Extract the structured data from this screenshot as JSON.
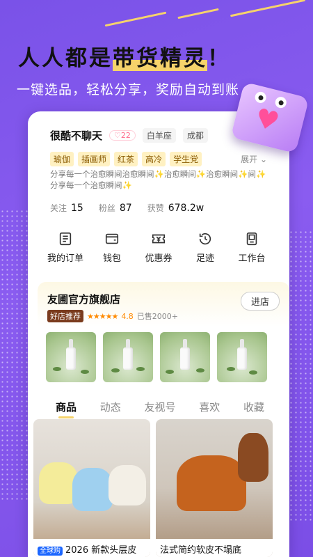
{
  "hero": {
    "headline_pre": "人人都是",
    "headline_hl": "带货精灵",
    "headline_post": "！",
    "subheadline": "一键选品，轻松分享，奖励自动到账"
  },
  "colors": {
    "background": "#7a52e8",
    "accent_yellow": "#f6d36b",
    "heart": "#ff4f9a"
  },
  "profile": {
    "username": "很酷不聊天",
    "fans_badge": "22",
    "zodiac": "白羊座",
    "city": "成都",
    "tags": [
      "瑜伽",
      "插画师",
      "红茶",
      "高冷",
      "学生党"
    ],
    "expand_label": "展开",
    "bio": "分享每一个治愈瞬间治愈瞬间✨治愈瞬间✨治愈瞬间✨间✨分享每一个治愈瞬间✨",
    "stats": [
      {
        "label": "关注",
        "value": "15"
      },
      {
        "label": "粉丝",
        "value": "87"
      },
      {
        "label": "获赞",
        "value": "678.2w"
      }
    ]
  },
  "menu": [
    {
      "label": "我的订单",
      "icon": "order-icon"
    },
    {
      "label": "钱包",
      "icon": "wallet-icon"
    },
    {
      "label": "优惠券",
      "icon": "coupon-icon"
    },
    {
      "label": "足迹",
      "icon": "footprint-icon"
    },
    {
      "label": "工作台",
      "icon": "workbench-icon"
    }
  ],
  "shop": {
    "name": "友圃官方旗舰店",
    "enter_label": "进店",
    "recommend_badge": "好店推荐",
    "stars": "★★★★★",
    "rating": "4.8",
    "sold": "已售2000+"
  },
  "tabs": [
    "商品",
    "动态",
    "友视号",
    "喜欢",
    "收藏"
  ],
  "products": [
    {
      "badge": "全球购",
      "title": "2026 新款头层皮"
    },
    {
      "badge": "",
      "title": "法式简约软皮不塌底"
    }
  ]
}
